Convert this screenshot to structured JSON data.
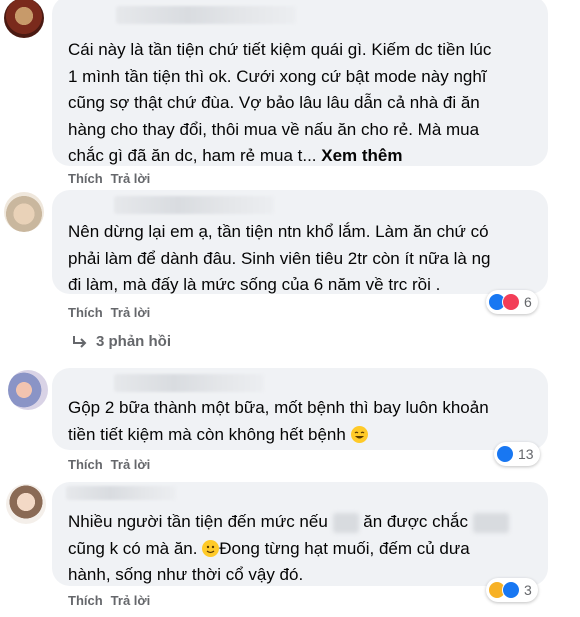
{
  "comments": [
    {
      "text": "Cái này là tần tiện chứ tiết kiệm quái gì. Kiếm dc tiền lúc\n1 mình tần tiện thì ok. Cưới xong cứ bật mode này nghĩ\ncũng sợ thật chứ đùa. Vợ bảo lâu lâu dẫn cả nhà đi ăn\nhàng cho thay đổi, thôi mua về nấu ăn cho rẻ. Mà mua\nchắc gì đã ăn dc, ham rẻ mua t... ",
      "see_more": "Xem thêm",
      "like": "Thích",
      "reply": "Trả lời"
    },
    {
      "text": "Nên dừng lại em ạ, tần tiện ntn khổ lắm. Làm ăn chứ có\nphải làm để dành đâu. Sinh viên tiêu 2tr còn ít nữa là ng\nđi làm, mà đấy là mức sống của 6 năm về trc rồi .",
      "like": "Thích",
      "reply": "Trả lời",
      "reaction_count": "6",
      "replies_label": "3 phản hồi"
    },
    {
      "text": "Gộp 2 bữa thành một bữa, mốt bệnh thì bay luôn khoản\ntiền tiết kiệm mà còn không hết bệnh",
      "like": "Thích",
      "reply": "Trả lời",
      "reaction_count": "13"
    },
    {
      "text_line1_a": "Nhiều người tần tiện đến mức nếu",
      "text_line1_b": "ăn được chắc",
      "text_line2": "cũng k có mà ăn.",
      "text_line2_b": "Đong từng hạt muối, đếm củ dưa",
      "text_line3": "hành, sống như thời cổ vậy đó.",
      "like": "Thích",
      "reply": "Trả lời",
      "reaction_count": "3"
    }
  ],
  "colors": {
    "bubble": "#f0f2f5",
    "secondary_text": "#65676b",
    "like_blue": "#1877f2",
    "love_red": "#f33e58",
    "haha_yellow": "#f7b125"
  },
  "icons": [
    "reply-arrow-icon",
    "like-reaction-icon",
    "love-reaction-icon",
    "haha-reaction-icon",
    "laughing-emoji-icon",
    "smiling-emoji-icon"
  ]
}
